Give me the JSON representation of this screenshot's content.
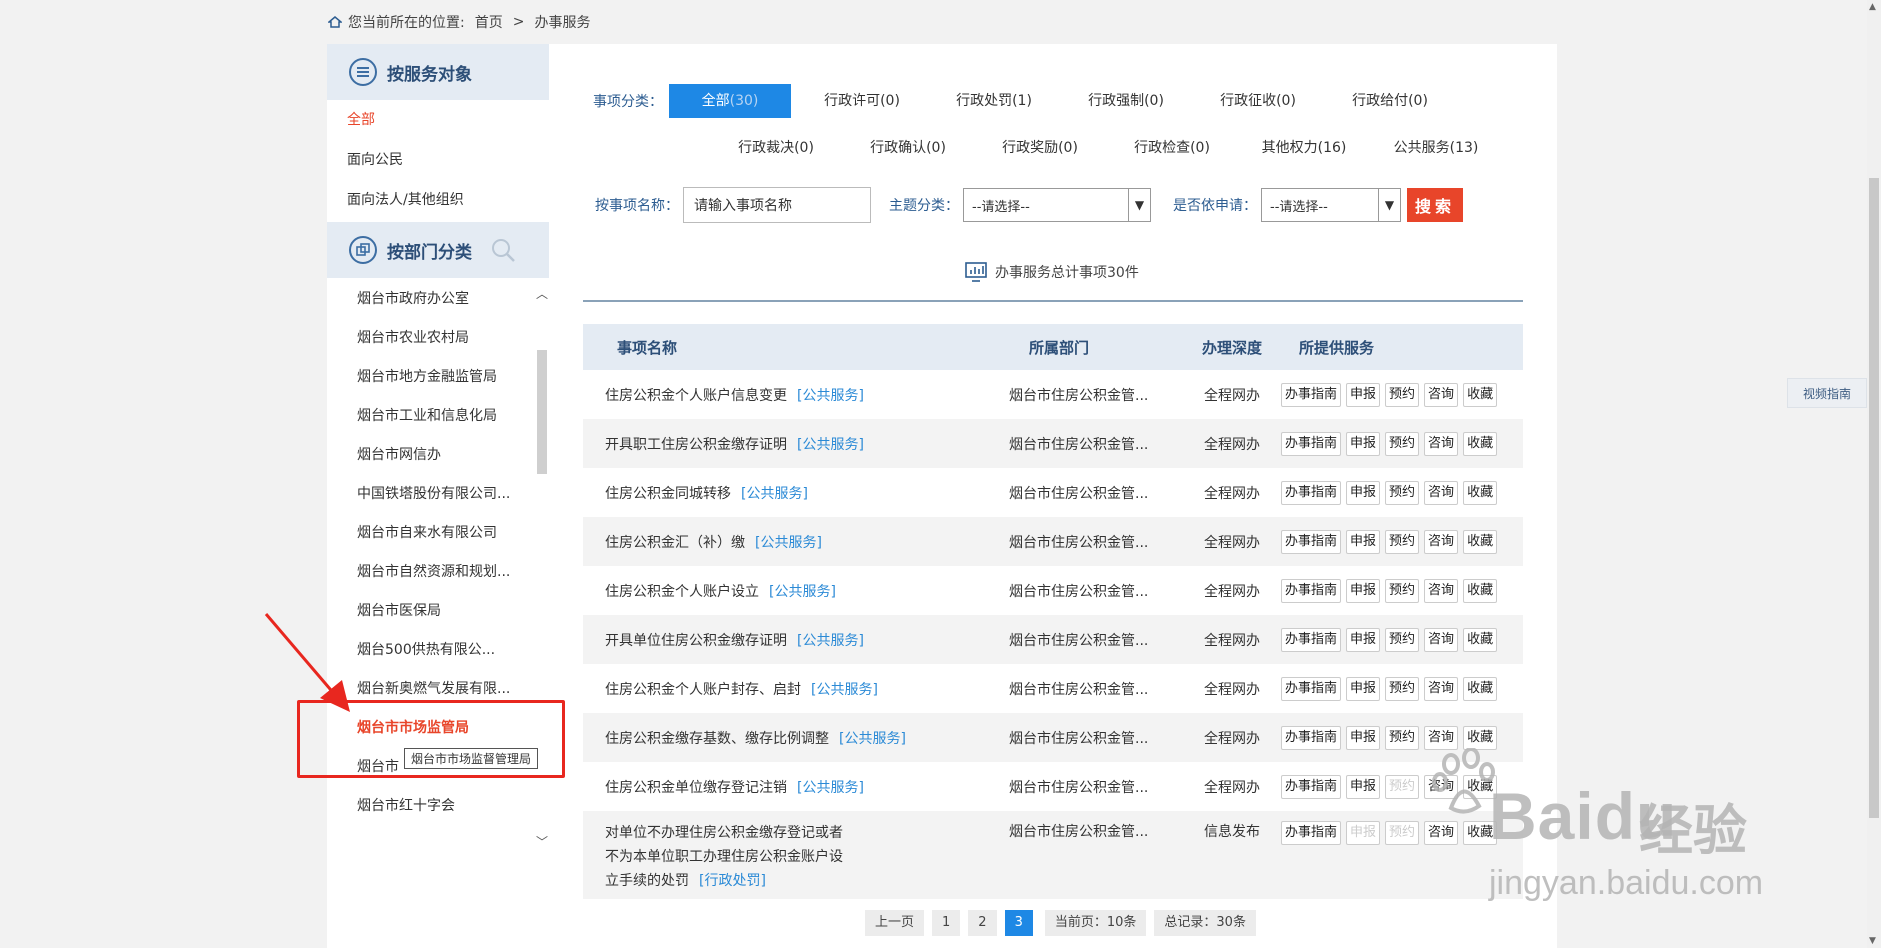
{
  "breadcrumb": {
    "prefix": "您当前所在的位置:",
    "home": "首页",
    "sep": ">",
    "current": "办事服务"
  },
  "sidebar": {
    "by_object_title": "按服务对象",
    "object_items": [
      {
        "label": "全部",
        "active": true
      },
      {
        "label": "面向公民",
        "active": false
      },
      {
        "label": "面向法人/其他组织",
        "active": false
      }
    ],
    "by_dept_title": "按部门分类",
    "dept_items": [
      "烟台市政府办公室",
      "烟台市农业农村局",
      "烟台市地方金融监管局",
      "烟台市工业和信息化局",
      "烟台市网信办",
      "中国铁塔股份有限公司...",
      "烟台市自来水有限公司",
      "烟台市自然资源和规划...",
      "烟台市医保局",
      "烟台500供热有限公...",
      "烟台新奥燃气发展有限...",
      "烟台市市场监管局",
      "烟台市",
      "烟台市红十字会"
    ],
    "active_dept_index": 11,
    "tooltip": "烟台市市场监督管理局"
  },
  "filters": {
    "label": "事项分类：",
    "row1": [
      {
        "name": "全部",
        "count": "(30)",
        "active": true
      },
      {
        "name": "行政许可",
        "count": "(0)"
      },
      {
        "name": "行政处罚",
        "count": "(1)"
      },
      {
        "name": "行政强制",
        "count": "(0)"
      },
      {
        "name": "行政征收",
        "count": "(0)"
      },
      {
        "name": "行政给付",
        "count": "(0)"
      }
    ],
    "row2": [
      {
        "name": "行政裁决",
        "count": "(0)"
      },
      {
        "name": "行政确认",
        "count": "(0)"
      },
      {
        "name": "行政奖励",
        "count": "(0)"
      },
      {
        "name": "行政检查",
        "count": "(0)"
      },
      {
        "name": "其他权力",
        "count": "(16)"
      },
      {
        "name": "公共服务",
        "count": "(13)"
      }
    ]
  },
  "search": {
    "name_label": "按事项名称：",
    "name_placeholder": "请输入事项名称",
    "theme_label": "主题分类：",
    "theme_value": "--请选择--",
    "apply_label": "是否依申请：",
    "apply_value": "--请选择--",
    "button": "搜索"
  },
  "total_text": "办事服务总计事项30件",
  "table": {
    "headers": {
      "name": "事项名称",
      "dept": "所属部门",
      "depth": "办理深度",
      "services": "所提供服务"
    },
    "rows": [
      {
        "name": "住房公积金个人账户信息变更",
        "tag": "[公共服务]",
        "dept": "烟台市住房公积金管...",
        "depth": "全程网办",
        "services": [
          "办事指南",
          "申报",
          "预约",
          "咨询",
          "收藏"
        ],
        "disabled": []
      },
      {
        "name": "开具职工住房公积金缴存证明",
        "tag": "[公共服务]",
        "dept": "烟台市住房公积金管...",
        "depth": "全程网办",
        "services": [
          "办事指南",
          "申报",
          "预约",
          "咨询",
          "收藏"
        ],
        "disabled": []
      },
      {
        "name": "住房公积金同城转移",
        "tag": "[公共服务]",
        "dept": "烟台市住房公积金管...",
        "depth": "全程网办",
        "services": [
          "办事指南",
          "申报",
          "预约",
          "咨询",
          "收藏"
        ],
        "disabled": []
      },
      {
        "name": "住房公积金汇（补）缴",
        "tag": "[公共服务]",
        "dept": "烟台市住房公积金管...",
        "depth": "全程网办",
        "services": [
          "办事指南",
          "申报",
          "预约",
          "咨询",
          "收藏"
        ],
        "disabled": []
      },
      {
        "name": "住房公积金个人账户设立",
        "tag": "[公共服务]",
        "dept": "烟台市住房公积金管...",
        "depth": "全程网办",
        "services": [
          "办事指南",
          "申报",
          "预约",
          "咨询",
          "收藏"
        ],
        "disabled": []
      },
      {
        "name": "开具单位住房公积金缴存证明",
        "tag": "[公共服务]",
        "dept": "烟台市住房公积金管...",
        "depth": "全程网办",
        "services": [
          "办事指南",
          "申报",
          "预约",
          "咨询",
          "收藏"
        ],
        "disabled": []
      },
      {
        "name": "住房公积金个人账户封存、启封",
        "tag": "[公共服务]",
        "dept": "烟台市住房公积金管...",
        "depth": "全程网办",
        "services": [
          "办事指南",
          "申报",
          "预约",
          "咨询",
          "收藏"
        ],
        "disabled": []
      },
      {
        "name": "住房公积金缴存基数、缴存比例调整",
        "tag": "[公共服务]",
        "dept": "烟台市住房公积金管...",
        "depth": "全程网办",
        "services": [
          "办事指南",
          "申报",
          "预约",
          "咨询",
          "收藏"
        ],
        "disabled": []
      },
      {
        "name": "住房公积金单位缴存登记注销",
        "tag": "[公共服务]",
        "dept": "烟台市住房公积金管...",
        "depth": "全程网办",
        "services": [
          "办事指南",
          "申报",
          "预约",
          "咨询",
          "收藏"
        ],
        "disabled": [
          2
        ]
      },
      {
        "name": "对单位不办理住房公积金缴存登记或者不为本单位职工办理住房公积金账户设立手续的处罚",
        "tag": "[行政处罚]",
        "dept": "烟台市住房公积金管...",
        "depth": "信息发布",
        "services": [
          "办事指南",
          "申报",
          "预约",
          "咨询",
          "收藏"
        ],
        "disabled": [
          1,
          2
        ]
      }
    ]
  },
  "pager": {
    "prev": "上一页",
    "pages": [
      "1",
      "2",
      "3"
    ],
    "current_page": "3",
    "per_page": "当前页：10条",
    "total": "总记录：30条"
  },
  "video_guide": "视频指南",
  "watermark": {
    "brand": "Baidu",
    "cn": "经验",
    "url": "jingyan.baidu.com"
  },
  "colors": {
    "accent_blue": "#1e88e5",
    "accent_red": "#e8452a",
    "header_bg": "#e4ebf3",
    "link_blue": "#2b8ad6"
  }
}
